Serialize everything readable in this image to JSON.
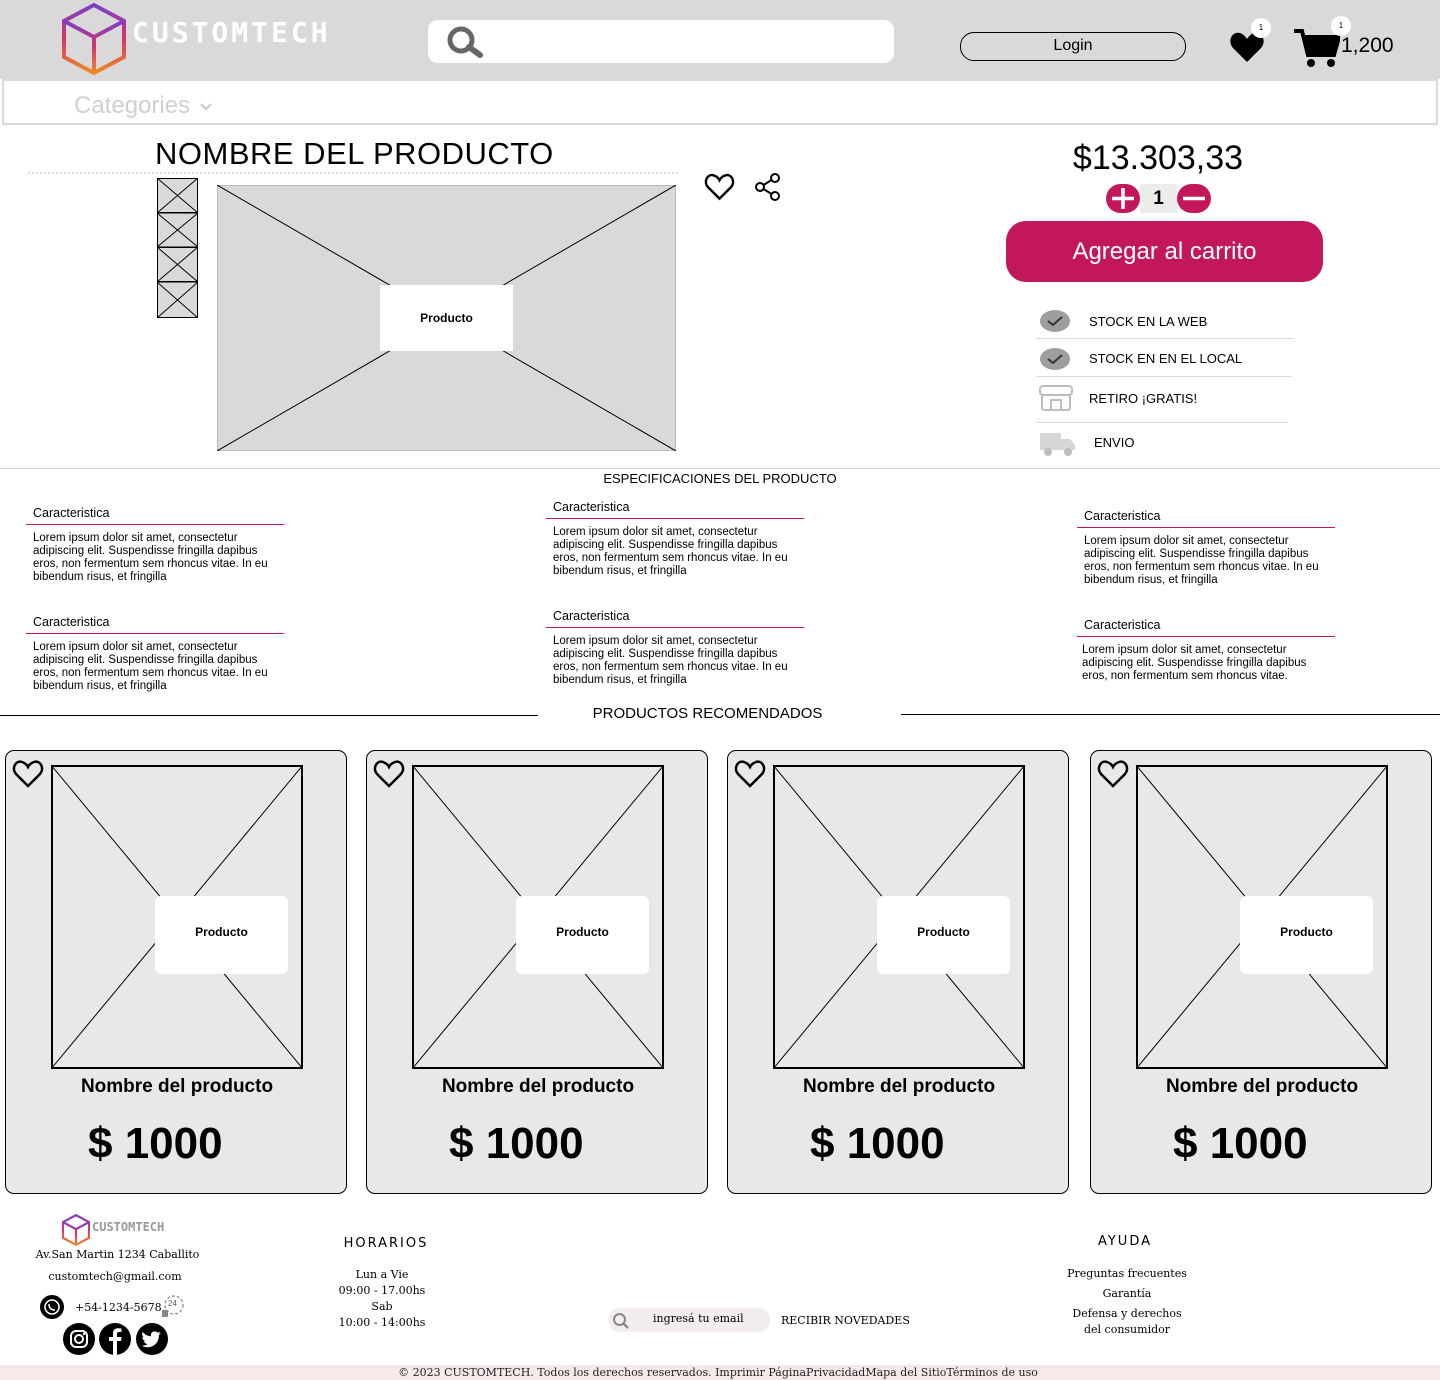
{
  "header": {
    "brand": "CUSTOMTECH",
    "login_label": "Login",
    "wishlist_count": "1",
    "cart_count": "1",
    "cart_total": "1,200"
  },
  "nav": {
    "categories_label": "Categories"
  },
  "product": {
    "name": "NOMBRE DEL PRODUCTO",
    "image_label": "Producto",
    "price": "$13.303,33",
    "quantity": "1",
    "add_to_cart": "Agregar al carrito",
    "availability": [
      {
        "label": "STOCK EN LA WEB",
        "icon": "check-icon"
      },
      {
        "label": "STOCK EN EN EL LOCAL",
        "icon": "check-icon"
      },
      {
        "label": "RETIRO ¡GRATIS!",
        "icon": "store-icon"
      },
      {
        "label": "ENVIO",
        "icon": "truck-icon"
      }
    ]
  },
  "specs": {
    "title": "ESPECIFICACIONES DEL PRODUCTO",
    "items": [
      {
        "heading": "Caracteristica",
        "body": "Lorem ipsum dolor sit amet, consectetur adipiscing elit. Suspendisse fringilla dapibus eros, non fermentum sem rhoncus vitae. In eu bibendum risus, et fringilla"
      },
      {
        "heading": "Caracteristica",
        "body": "Lorem ipsum dolor sit amet, consectetur adipiscing elit. Suspendisse fringilla dapibus eros, non fermentum sem rhoncus vitae. In eu bibendum risus, et fringilla"
      },
      {
        "heading": "Caracteristica",
        "body": "Lorem ipsum dolor sit amet, consectetur adipiscing elit. Suspendisse fringilla dapibus eros, non fermentum sem rhoncus vitae. In eu bibendum risus, et fringilla"
      },
      {
        "heading": "Caracteristica",
        "body": "Lorem ipsum dolor sit amet, consectetur adipiscing elit. Suspendisse fringilla dapibus eros, non fermentum sem rhoncus vitae. In eu bibendum risus, et fringilla"
      },
      {
        "heading": "Caracteristica",
        "body": "Lorem ipsum dolor sit amet, consectetur adipiscing elit. Suspendisse fringilla dapibus eros, non fermentum sem rhoncus vitae. In eu bibendum risus, et fringilla"
      },
      {
        "heading": "Caracteristica",
        "body": "Lorem ipsum dolor sit amet, consectetur adipiscing elit. Suspendisse fringilla dapibus eros, non fermentum sem rhoncus vitae."
      }
    ]
  },
  "recommended": {
    "title": "PRODUCTOS RECOMENDADOS",
    "items": [
      {
        "image_label": "Producto",
        "name": "Nombre del producto",
        "price": "$ 1000"
      },
      {
        "image_label": "Producto",
        "name": "Nombre del producto",
        "price": "$ 1000"
      },
      {
        "image_label": "Producto",
        "name": "Nombre del producto",
        "price": "$ 1000"
      },
      {
        "image_label": "Producto",
        "name": "Nombre del producto",
        "price": "$ 1000"
      }
    ]
  },
  "footer": {
    "brand": "CUSTOMTECH",
    "address": "Av.San Martin 1234 Caballito",
    "email": "customtech@gmail.com",
    "phone": "+54-1234-5678",
    "support_badge": "24",
    "hours_title": "HORARIOS",
    "hours_1_days": "Lun a Vie",
    "hours_1_time": "09:00 - 17.00hs",
    "hours_2_days": "Sab",
    "hours_2_time": "10:00 - 14:00hs",
    "newsletter_placeholder": "ingresá tu email",
    "newsletter_button": "RECIBIR NOVEDADES",
    "help_title": "AYUDA",
    "help_links": [
      "Preguntas frecuentes",
      "Garantía",
      "Defensa y derechos",
      "del consumidor"
    ],
    "copyright": "© 2023 CUSTOMTECH. Todos los derechos reservados. Imprimir PáginaPrivacidadMapa del SitioTérminos de uso"
  },
  "colors": {
    "accent": "#c2185b",
    "header_bg": "#d9d9d9",
    "card_bg": "#e8e8e8"
  }
}
